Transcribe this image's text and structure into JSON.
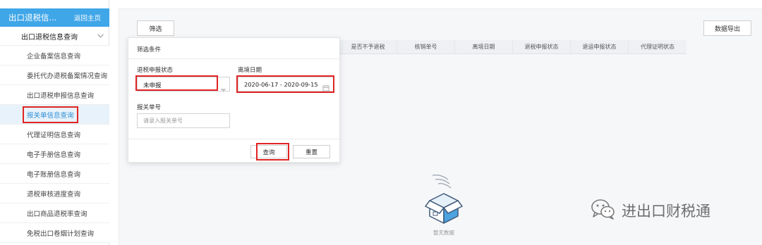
{
  "sidebar": {
    "header_title": "出口退税信...",
    "back_link": "返回主页",
    "group_label": "出口退税信息查询",
    "items": [
      {
        "label": "企业备案信息查询"
      },
      {
        "label": "委托代办退税备案情况查询"
      },
      {
        "label": "出口退税申报信息查询"
      },
      {
        "label": "报关单信息查询"
      },
      {
        "label": "代理证明信息查询"
      },
      {
        "label": "电子手册信息查询"
      },
      {
        "label": "电子账册信息查询"
      },
      {
        "label": "退税审核进度查询"
      },
      {
        "label": "出口商品退税率查询"
      },
      {
        "label": "免税出口卷烟计划查询"
      }
    ]
  },
  "toolbar": {
    "filter_label": "筛选",
    "export_label": "数据导出"
  },
  "table": {
    "columns": [
      "是否不予退税",
      "核销单号",
      "离境日期",
      "退税申报状态",
      "退运申报状态",
      "代理证明状态"
    ]
  },
  "empty": {
    "text": "暂无数据"
  },
  "filter_panel": {
    "title": "筛选条件",
    "status_label": "退税申报状态",
    "status_value": "未申报",
    "date_label": "离境日期",
    "date_value": "2020-06-17 - 2020-09-15",
    "decl_label": "报关单号",
    "decl_placeholder": "请录入报关单号",
    "query_label": "查询",
    "reset_label": "重置"
  },
  "watermark": {
    "text": "进出口财税通"
  }
}
